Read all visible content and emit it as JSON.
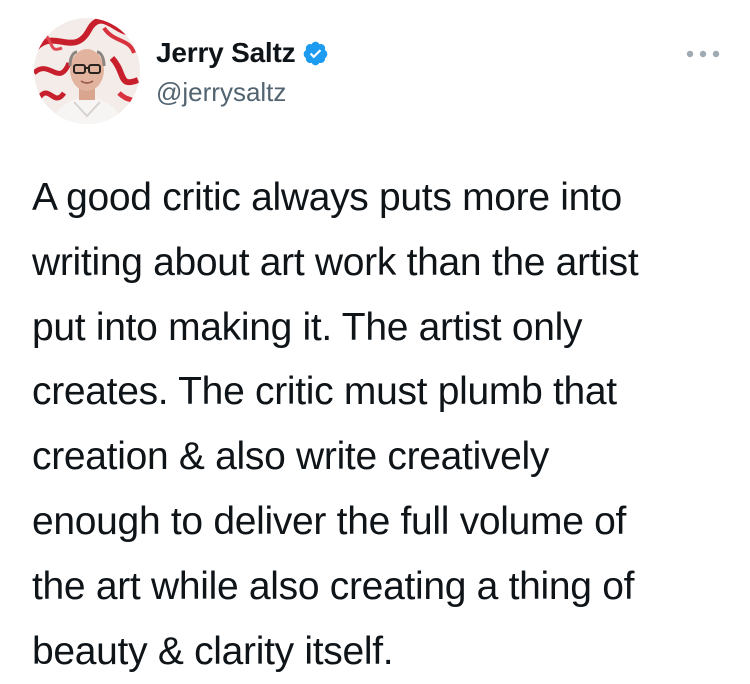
{
  "tweet": {
    "author": {
      "display_name": "Jerry Saltz",
      "handle": "@jerrysaltz",
      "verified": true,
      "avatar_icon": "profile-photo",
      "verified_icon": "verified-badge-icon"
    },
    "more_icon": "more-options-icon",
    "text_lines": [
      "A good critic always puts more into",
      "writing about art work than the artist",
      "put into making it. The artist only",
      "creates. The critic must plumb that",
      "creation & also write creatively",
      "enough to deliver the full volume of",
      "the art while also creating a thing of",
      "beauty & clarity itself."
    ]
  },
  "colors": {
    "text": "#0f1419",
    "secondary_text": "#536471",
    "verified_blue": "#1d9bf0",
    "more_dots": "#a0aab3",
    "avatar_red": "#c81f2c"
  }
}
